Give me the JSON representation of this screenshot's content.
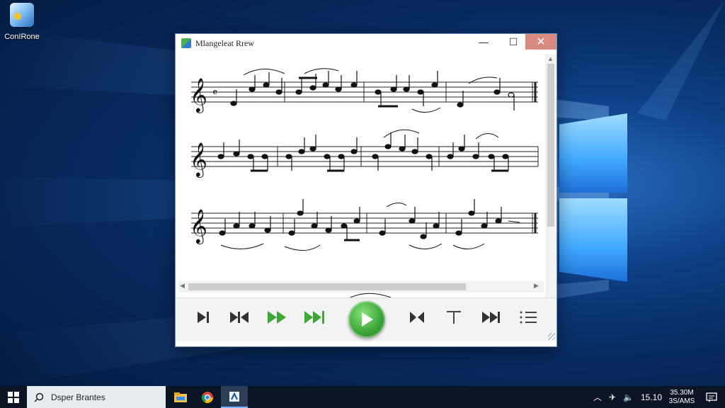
{
  "desktop": {
    "icon_label": "ConIRone"
  },
  "window": {
    "title": "Mlangeleat Rrew",
    "minimize": "—",
    "maximize": "☐",
    "close": "✕"
  },
  "score": {
    "staves": 3,
    "clef": "treble"
  },
  "controls": {
    "buttons": [
      {
        "name": "step-forward",
        "icon": "step-forward-icon"
      },
      {
        "name": "skip-back",
        "icon": "skip-back-icon"
      },
      {
        "name": "fast-forward",
        "icon": "fast-forward-icon"
      },
      {
        "name": "fast-forward-end",
        "icon": "fast-forward-end-icon"
      },
      {
        "name": "play",
        "icon": "play-icon"
      },
      {
        "name": "previous",
        "icon": "previous-icon"
      },
      {
        "name": "text-tool",
        "icon": "text-icon"
      },
      {
        "name": "next",
        "icon": "next-icon"
      },
      {
        "name": "playlist",
        "icon": "playlist-icon"
      }
    ]
  },
  "taskbar": {
    "search_text": "Dsper Brantes",
    "tray_temp": "15.10",
    "clock_time": "35.30M",
    "clock_date": "3S/AMS"
  },
  "colors": {
    "play_green": "#3da73a",
    "close_red": "#d98a7f",
    "taskbar": "#0a1424"
  }
}
